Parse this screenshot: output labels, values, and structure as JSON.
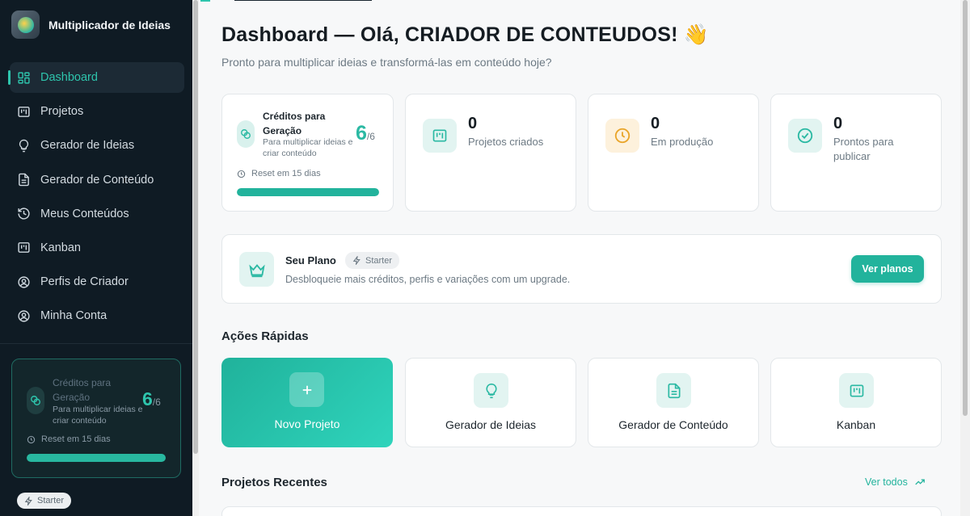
{
  "app": {
    "name": "Multiplicador de Ideias"
  },
  "sidebar": {
    "items": [
      {
        "label": "Dashboard",
        "icon": "dashboard-icon"
      },
      {
        "label": "Projetos",
        "icon": "kanban-board-icon"
      },
      {
        "label": "Gerador de Ideias",
        "icon": "lightbulb-icon"
      },
      {
        "label": "Gerador de Conteúdo",
        "icon": "document-icon"
      },
      {
        "label": "Meus Conteúdos",
        "icon": "history-icon"
      },
      {
        "label": "Kanban",
        "icon": "kanban-board-icon"
      },
      {
        "label": "Perfis de Criador",
        "icon": "user-circle-icon"
      },
      {
        "label": "Minha Conta",
        "icon": "user-circle-icon"
      }
    ],
    "credits": {
      "title": "Créditos para Geração",
      "description": "Para multiplicar ideias e criar conteúdo",
      "value": "6",
      "total": "/6",
      "reset": "Reset em 15 dias",
      "progress": 1.0
    },
    "plan_badge": "Starter"
  },
  "header": {
    "title": "Dashboard — Olá, CRIADOR DE CONTEUDOS! 👋",
    "subtitle": "Pronto para multiplicar ideias e transformá-las em conteúdo hoje?"
  },
  "credits": {
    "title": "Créditos para Geração",
    "description": "Para multiplicar ideias e criar conteúdo",
    "value": "6",
    "total": "/6",
    "reset": "Reset em 15 dias",
    "progress": 1.0
  },
  "stats": [
    {
      "value": "0",
      "label": "Projetos criados",
      "icon": "kanban-board-icon",
      "color": "#2bb9a3",
      "bg": "#e2f4f1"
    },
    {
      "value": "0",
      "label": "Em produção",
      "icon": "clock-icon",
      "color": "#e9a52a",
      "bg": "#fdf1dc"
    },
    {
      "value": "0",
      "label": "Prontos para publicar",
      "icon": "check-circle-icon",
      "color": "#2bb9a3",
      "bg": "#e2f4f1"
    }
  ],
  "plan": {
    "name": "Seu Plano",
    "badge": "Starter",
    "description": "Desbloqueie mais créditos, perfis e variações com um upgrade.",
    "button": "Ver planos"
  },
  "quick_actions": {
    "title": "Ações Rápidas",
    "items": [
      {
        "label": "Novo Projeto",
        "icon": "plus-icon"
      },
      {
        "label": "Gerador de Ideias",
        "icon": "lightbulb-icon"
      },
      {
        "label": "Gerador de Conteúdo",
        "icon": "document-icon"
      },
      {
        "label": "Kanban",
        "icon": "kanban-board-icon"
      }
    ]
  },
  "recent": {
    "title": "Projetos Recentes",
    "link": "Ver todos"
  },
  "colors": {
    "accent": "#22b39c",
    "sidebar_bg": "#0f1b24"
  }
}
